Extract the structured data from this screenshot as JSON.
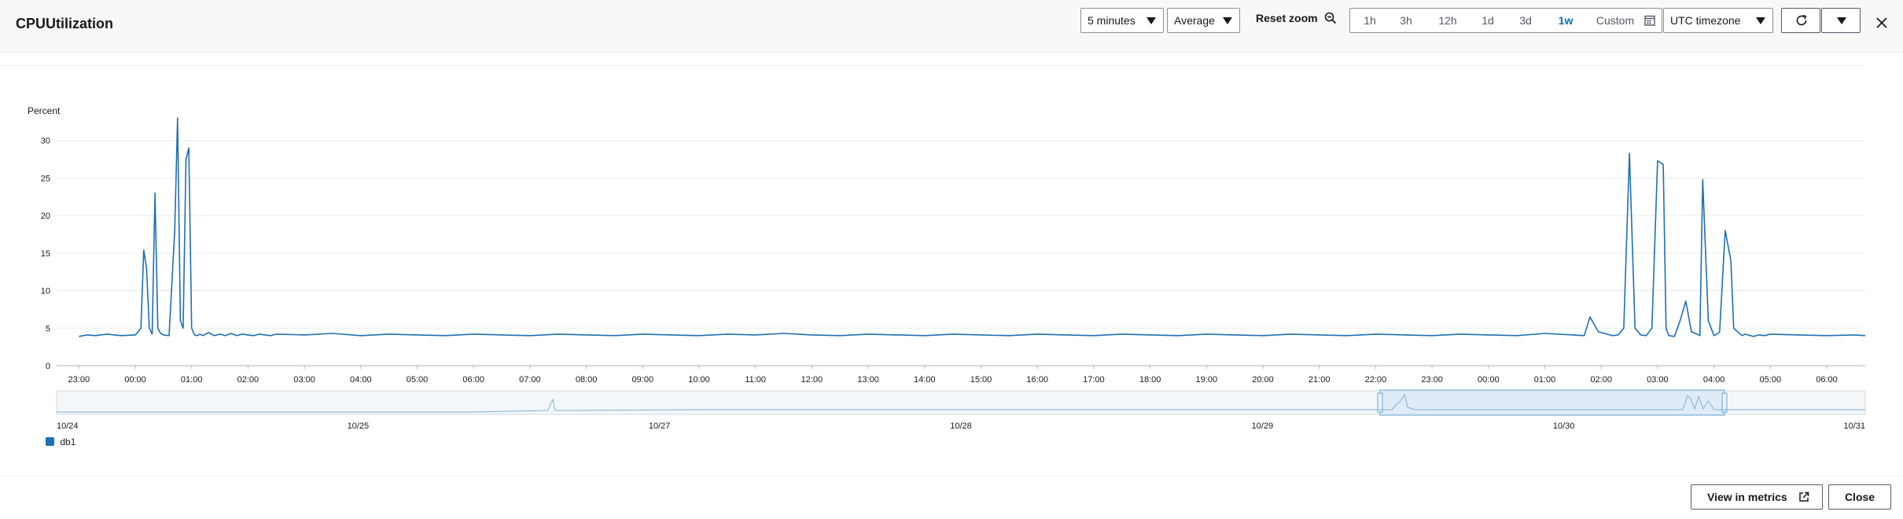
{
  "header": {
    "title": "CPUUtilization",
    "period": "5 minutes",
    "statistic": "Average",
    "reset_zoom": "Reset zoom",
    "ranges": [
      "1h",
      "3h",
      "12h",
      "1d",
      "3d",
      "1w",
      "Custom"
    ],
    "active_range": "1w",
    "timezone": "UTC timezone"
  },
  "chart_data": {
    "type": "line",
    "ylabel": "Percent",
    "ylim": [
      0,
      33
    ],
    "y_ticks": [
      "0",
      "5",
      "10",
      "15",
      "20",
      "25",
      "30"
    ],
    "x_ticks": [
      "23:00",
      "00:00",
      "01:00",
      "02:00",
      "03:00",
      "04:00",
      "05:00",
      "06:00",
      "07:00",
      "08:00",
      "09:00",
      "10:00",
      "11:00",
      "12:00",
      "13:00",
      "14:00",
      "15:00",
      "16:00",
      "17:00",
      "18:00",
      "19:00",
      "20:00",
      "21:00",
      "22:00",
      "23:00",
      "00:00",
      "01:00",
      "02:00",
      "03:00",
      "04:00",
      "05:00",
      "06:00"
    ],
    "grid": true,
    "legend_position": "bottom-left",
    "series": [
      {
        "name": "db1",
        "color": "#1f6fb4",
        "x": [
          0,
          0.15,
          0.3,
          0.5,
          0.75,
          1.0,
          1.05,
          1.1,
          1.15,
          1.2,
          1.25,
          1.3,
          1.35,
          1.4,
          1.45,
          1.5,
          1.6,
          1.7,
          1.75,
          1.8,
          1.85,
          1.9,
          1.95,
          2.0,
          2.05,
          2.1,
          2.15,
          2.2,
          2.3,
          2.4,
          2.5,
          2.6,
          2.7,
          2.8,
          2.9,
          3.0,
          3.1,
          3.2,
          3.3,
          3.4,
          3.5,
          4.0,
          4.5,
          5.0,
          5.5,
          6.0,
          6.5,
          7.0,
          7.5,
          8.0,
          8.5,
          9.0,
          9.5,
          10.0,
          10.5,
          11.0,
          11.5,
          12.0,
          12.5,
          13.0,
          13.5,
          14.0,
          14.5,
          15.0,
          15.5,
          16.0,
          16.5,
          17.0,
          17.5,
          18.0,
          18.5,
          19.0,
          19.5,
          20.0,
          20.5,
          21.0,
          21.5,
          22.0,
          22.5,
          23.0,
          23.5,
          24.0,
          24.5,
          25.0,
          25.5,
          26.0,
          26.5,
          26.7,
          26.8,
          26.95,
          27.1,
          27.2,
          27.3,
          27.4,
          27.5,
          27.6,
          27.7,
          27.8,
          27.9,
          28.0,
          28.1,
          28.15,
          28.2,
          28.3,
          28.4,
          28.5,
          28.6,
          28.7,
          28.75,
          28.8,
          28.9,
          29.0,
          29.05,
          29.1,
          29.2,
          29.3,
          29.35,
          29.45,
          29.5,
          29.55,
          29.6,
          29.7,
          29.8,
          29.9,
          30.0,
          30.5,
          31.0,
          31.5,
          31.86
        ],
        "values": [
          3.9,
          4.1,
          4.0,
          4.2,
          4.0,
          4.1,
          4.5,
          5.0,
          15.4,
          13.0,
          5.0,
          4.2,
          23.0,
          5.0,
          4.3,
          4.1,
          4.0,
          18.0,
          33.0,
          6.0,
          5.0,
          27.5,
          29.0,
          5.0,
          4.1,
          4.0,
          4.2,
          4.0,
          4.4,
          4.0,
          4.2,
          4.0,
          4.3,
          4.0,
          4.2,
          4.1,
          4.0,
          4.2,
          4.1,
          4.0,
          4.2,
          4.1,
          4.3,
          4.0,
          4.2,
          4.1,
          4.0,
          4.2,
          4.1,
          4.0,
          4.2,
          4.1,
          4.0,
          4.2,
          4.1,
          4.0,
          4.2,
          4.1,
          4.3,
          4.1,
          4.0,
          4.2,
          4.1,
          4.0,
          4.2,
          4.1,
          4.0,
          4.2,
          4.1,
          4.0,
          4.2,
          4.1,
          4.0,
          4.2,
          4.1,
          4.0,
          4.2,
          4.1,
          4.0,
          4.2,
          4.1,
          4.0,
          4.2,
          4.1,
          4.0,
          4.3,
          4.1,
          4.0,
          6.5,
          4.5,
          4.2,
          4.0,
          4.1,
          5.0,
          28.3,
          5.0,
          4.1,
          4.0,
          5.0,
          27.3,
          26.8,
          5.0,
          4.0,
          3.9,
          6.0,
          8.6,
          4.5,
          4.2,
          4.0,
          24.8,
          6.0,
          4.0,
          4.2,
          4.5,
          18.0,
          14.0,
          5.0,
          4.3,
          4.0,
          4.2,
          4.1,
          3.9,
          4.1,
          4.0,
          4.2,
          4.1,
          4.0,
          4.1,
          4.0
        ]
      }
    ]
  },
  "overview": {
    "date_ticks": [
      "10/24",
      "10/25",
      "10/27",
      "10/28",
      "10/29",
      "10/30",
      "10/31"
    ]
  },
  "legend": {
    "label": "db1",
    "color": "#1f6fb4"
  },
  "footer": {
    "view_metrics": "View in metrics",
    "close": "Close"
  }
}
